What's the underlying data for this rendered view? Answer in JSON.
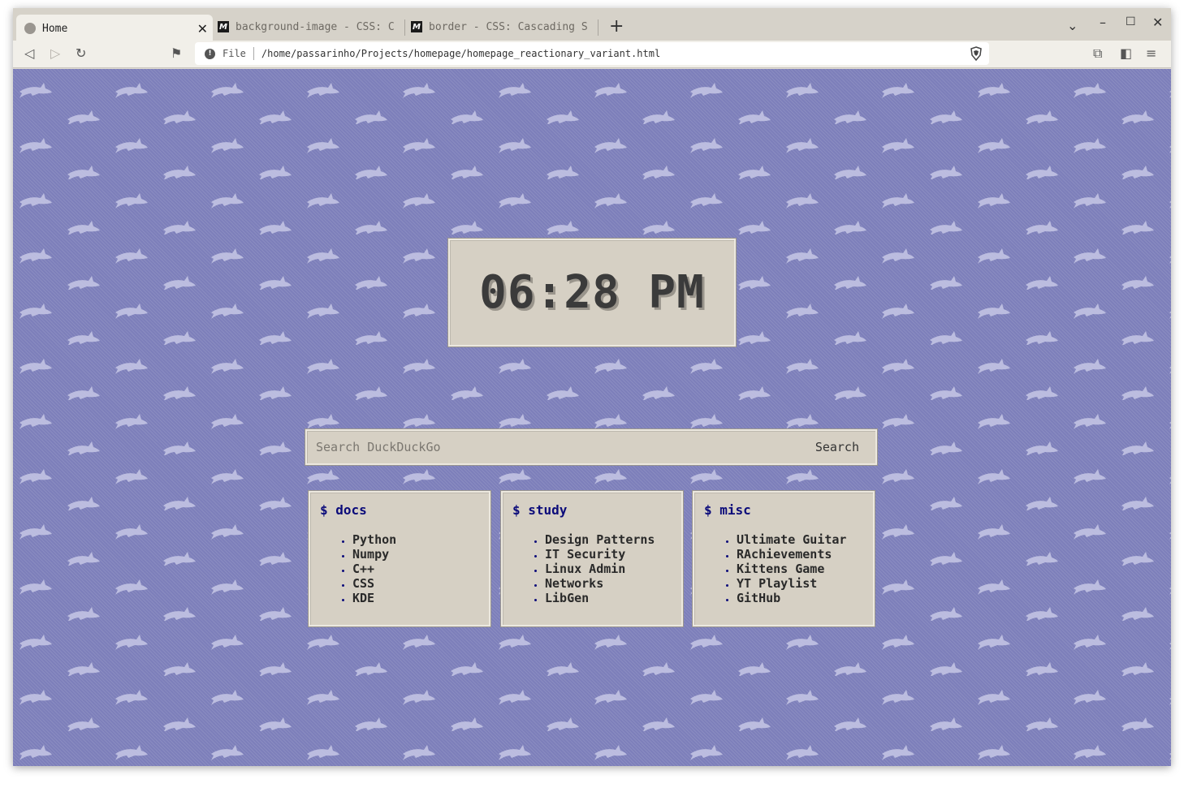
{
  "tabs": [
    {
      "title": "Home",
      "favicon": "globe-icon",
      "active": true
    },
    {
      "title": "background-image - CSS: C",
      "favicon": "mdn-icon",
      "active": false
    },
    {
      "title": "border - CSS: Cascading S",
      "favicon": "mdn-icon",
      "active": false
    }
  ],
  "toolbar": {
    "scheme": "File",
    "url": "/home/passarinho/Projects/homepage/homepage_reactionary_variant.html"
  },
  "clock": {
    "time": "06:28 PM"
  },
  "search": {
    "placeholder": "Search DuckDuckGo",
    "button": "Search"
  },
  "boxes": [
    {
      "title": "$ docs",
      "items": [
        "Python",
        "Numpy",
        "C++",
        "CSS",
        "KDE"
      ]
    },
    {
      "title": "$ study",
      "items": [
        "Design Patterns",
        "IT Security",
        "Linux Admin",
        "Networks",
        "LibGen"
      ]
    },
    {
      "title": "$ misc",
      "items": [
        "Ultimate Guitar",
        "RAchievements",
        "Kittens Game",
        "YT Playlist",
        "GitHub"
      ]
    }
  ],
  "colors": {
    "page_bg": "#7d7fba",
    "panel_bg": "#d6d0c4",
    "heading": "#0b0b7a"
  }
}
